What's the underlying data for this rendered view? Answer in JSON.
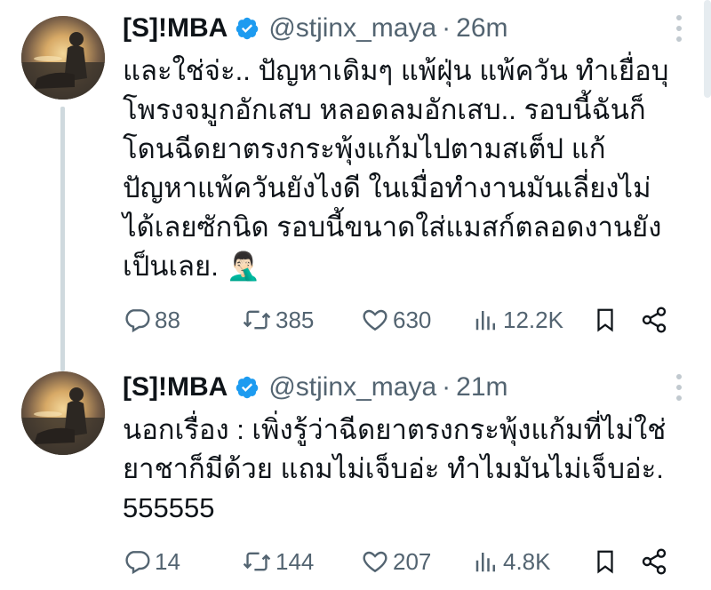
{
  "tweets": [
    {
      "name": "[S]!MBA",
      "handle": "@stjinx_maya",
      "separator": "·",
      "time": "26m",
      "lines": [
        "และใช่จ่ะ.. ปัญหาเดิมๆ แพ้ฝุ่น แพ้ควัน ทำเยื่อบุ",
        "โพรงจมูกอักเสบ หลอดลมอักเสบ.. รอบนี้ฉันก็",
        "โดนฉีดยาตรงกระพุ้งแก้มไปตามสเต็ป แก้",
        "ปัญหาแพ้ควันยังไงดี ในเมื่อทำงานมันเลี่ยงไม่",
        "ได้เลยซักนิด รอบนี้ขนาดใส่แมสก์ตลอดงานยัง",
        "เป็นเลย. 🤦🏻‍♂️"
      ],
      "replies": "88",
      "retweets": "385",
      "likes": "630",
      "views": "12.2K"
    },
    {
      "name": "[S]!MBA",
      "handle": "@stjinx_maya",
      "separator": "·",
      "time": "21m",
      "lines": [
        "นอกเรื่อง : เพิ่งรู้ว่าฉีดยาตรงกระพุ้งแก้มที่ไม่ใช่",
        "ยาชาก็มีด้วย แถมไม่เจ็บอ่ะ ทำไมมันไม่เจ็บอ่ะ.",
        "555555"
      ],
      "replies": "14",
      "retweets": "144",
      "likes": "207",
      "views": "4.8K"
    }
  ],
  "icons": {
    "verified": "verified-badge-icon",
    "more": "more-options-icon",
    "reply": "reply-icon",
    "retweet": "retweet-icon",
    "like": "heart-icon",
    "views": "views-icon",
    "bookmark": "bookmark-icon",
    "share": "share-icon"
  },
  "colors": {
    "text": "#0f1419",
    "secondary": "#536471",
    "verified": "#1d9bf0",
    "thread_line": "#cfd9de"
  }
}
